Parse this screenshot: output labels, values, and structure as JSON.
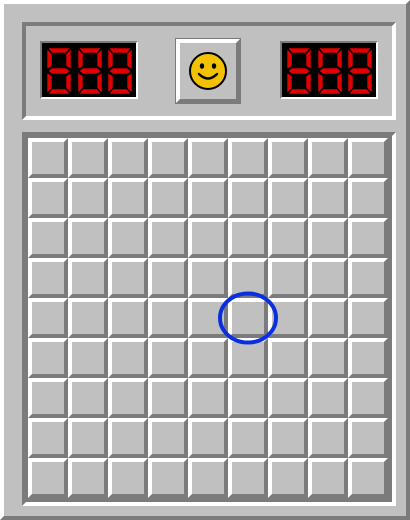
{
  "header": {
    "mine_counter": {
      "digits": [
        "8",
        "8",
        "8"
      ],
      "lit": [
        false,
        false,
        false
      ]
    },
    "face": {
      "state": "smile-icon"
    },
    "timer": {
      "digits": [
        "8",
        "8",
        "8"
      ],
      "lit": [
        false,
        false,
        false
      ]
    }
  },
  "board": {
    "rows": 9,
    "cols": 9,
    "cells_state": "covered"
  },
  "colors": {
    "face_gray": "#c0c0c0",
    "digit_on": "#ff0000",
    "digit_off": "#8a0000",
    "cursor": "#0a2fe0",
    "smiley": "#f2c200"
  }
}
